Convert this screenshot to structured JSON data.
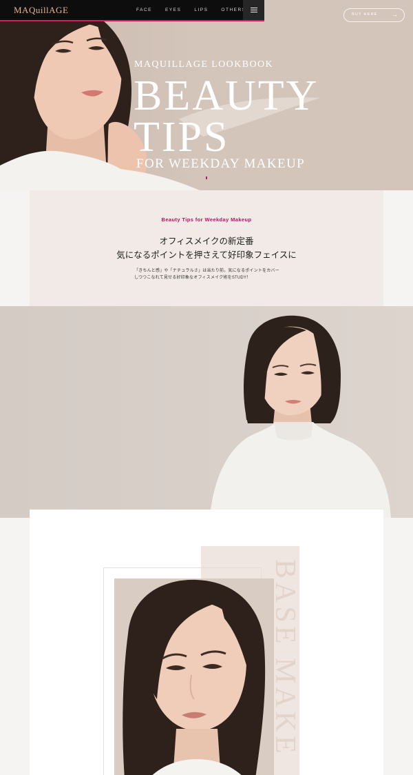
{
  "header": {
    "logo": "MAQuillAGE",
    "nav": [
      "FACE",
      "EYES",
      "LIPS",
      "OTHERS"
    ],
    "buy_label": "BUY HERE"
  },
  "hero": {
    "eyebrow": "MAQUILLAGE LOOKBOOK",
    "title_line1": "BEAUTY",
    "title_line2": "TIPS",
    "subtitle": "FOR WEEKDAY MAKEUP"
  },
  "intro": {
    "eyebrow": "Beauty Tips for Weekday Makeup",
    "heading_line1": "オフィスメイクの新定番",
    "heading_line2": "気になるポイントを押さえて好印象フェイスに",
    "body_line1": "「きちんと感」や「ナチュラルさ」は当たり前。気になるポイントをカバー",
    "body_line2": "しつつこなれて見せる好印象なオフィスメイク術をSTUDY！"
  },
  "section": {
    "vertical_title": "BASE MAKE"
  },
  "colors": {
    "accent": "#c2185b",
    "hero_bg": "#d4c5bb",
    "intro_bg": "#f1eae6",
    "band_bg": "#d2c9c1"
  }
}
